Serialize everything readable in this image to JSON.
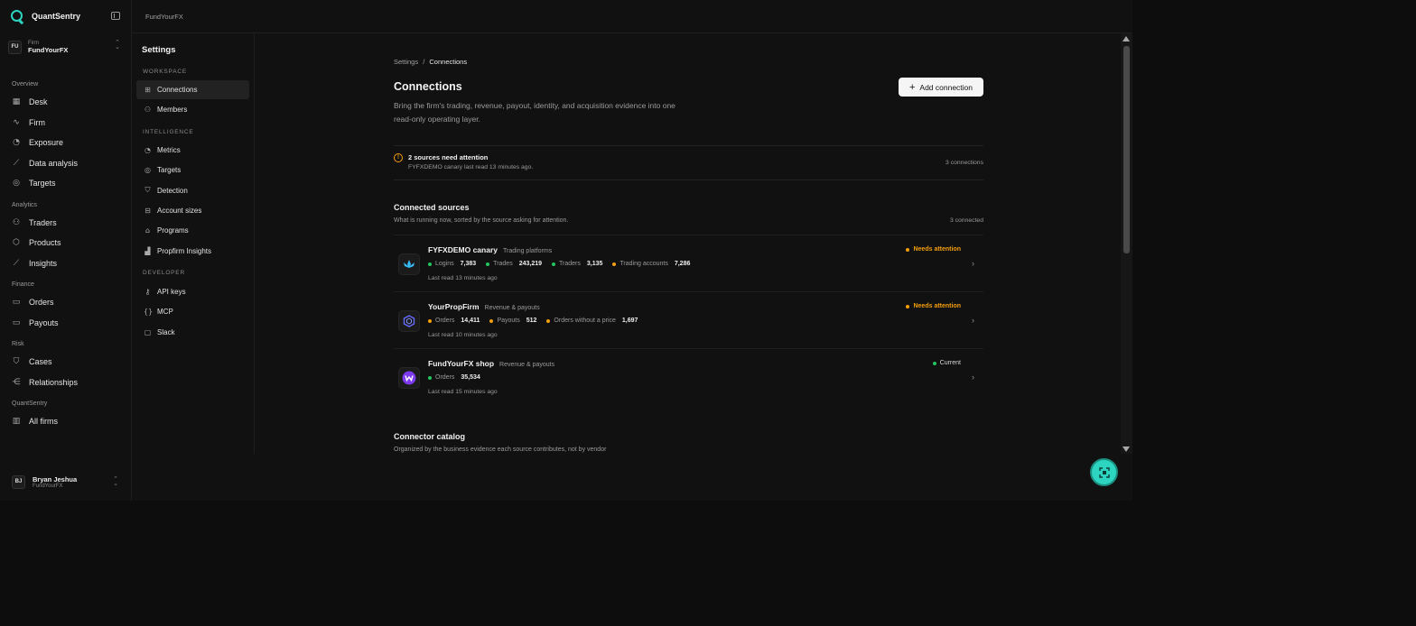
{
  "brand": {
    "name": "QuantSentry"
  },
  "firm_switcher": {
    "avatar": "FU",
    "caption": "Firm",
    "name": "FundYourFX"
  },
  "nav": [
    {
      "title": "Overview",
      "items": [
        {
          "label": "Desk",
          "icon": "grid-icon"
        },
        {
          "label": "Firm",
          "icon": "activity-icon"
        },
        {
          "label": "Exposure",
          "icon": "gauge-icon"
        },
        {
          "label": "Data analysis",
          "icon": "chart-line-icon"
        },
        {
          "label": "Targets",
          "icon": "target-icon"
        }
      ]
    },
    {
      "title": "Analytics",
      "items": [
        {
          "label": "Traders",
          "icon": "users-icon"
        },
        {
          "label": "Products",
          "icon": "box-icon"
        },
        {
          "label": "Insights",
          "icon": "chart-line-icon"
        }
      ]
    },
    {
      "title": "Finance",
      "items": [
        {
          "label": "Orders",
          "icon": "receipt-icon"
        },
        {
          "label": "Payouts",
          "icon": "wallet-icon"
        }
      ]
    },
    {
      "title": "Risk",
      "items": [
        {
          "label": "Cases",
          "icon": "shield-icon"
        },
        {
          "label": "Relationships",
          "icon": "share-icon"
        }
      ]
    },
    {
      "title": "QuantSentry",
      "items": [
        {
          "label": "All firms",
          "icon": "building-icon"
        }
      ]
    }
  ],
  "user": {
    "avatar": "BJ",
    "name": "Bryan Jeshua",
    "firm": "FundYourFX"
  },
  "topbar": {
    "title": "FundYourFX"
  },
  "settings": {
    "title": "Settings",
    "sections": [
      {
        "title": "WORKSPACE",
        "items": [
          {
            "label": "Connections",
            "icon": "plug-icon",
            "active": true
          },
          {
            "label": "Members",
            "icon": "users-icon"
          }
        ]
      },
      {
        "title": "INTELLIGENCE",
        "items": [
          {
            "label": "Metrics",
            "icon": "gauge-icon"
          },
          {
            "label": "Targets",
            "icon": "target-icon"
          },
          {
            "label": "Detection",
            "icon": "shield-check-icon"
          },
          {
            "label": "Account sizes",
            "icon": "database-icon"
          },
          {
            "label": "Programs",
            "icon": "landmark-icon"
          },
          {
            "label": "Propfirm Insights",
            "icon": "bar-chart-icon"
          }
        ]
      },
      {
        "title": "DEVELOPER",
        "items": [
          {
            "label": "API keys",
            "icon": "key-icon"
          },
          {
            "label": "MCP",
            "icon": "braces-icon"
          },
          {
            "label": "Slack",
            "icon": "message-icon"
          }
        ]
      }
    ]
  },
  "page": {
    "breadcrumb_root": "Settings",
    "breadcrumb_sep": "/",
    "breadcrumb_current": "Connections",
    "title": "Connections",
    "description": "Bring the firm's trading, revenue, payout, identity, and acquisition evidence into one read-only operating layer.",
    "add_button": "Add connection"
  },
  "alert": {
    "icon": "!",
    "title": "2 sources need attention",
    "subtitle": "FYFXDEMO canary last read 13 minutes ago.",
    "count": "3 connections"
  },
  "connected": {
    "title": "Connected sources",
    "subtitle": "What is running now, sorted by the source asking for attention.",
    "count": "3 connected",
    "rows": [
      {
        "name": "FYFXDEMO canary",
        "category": "Trading platforms",
        "logo": "lotus-icon",
        "status": "Needs attention",
        "status_color": "#f59e0b",
        "metrics": [
          {
            "label": "Logins",
            "value": "7,383",
            "color": "#22c55e"
          },
          {
            "label": "Trades",
            "value": "243,219",
            "color": "#22c55e"
          },
          {
            "label": "Traders",
            "value": "3,135",
            "color": "#22c55e"
          },
          {
            "label": "Trading accounts",
            "value": "7,286",
            "color": "#f59e0b"
          }
        ],
        "last_read": "Last read 13 minutes ago"
      },
      {
        "name": "YourPropFirm",
        "category": "Revenue & payouts",
        "logo": "hexagon-icon",
        "status": "Needs attention",
        "status_color": "#f59e0b",
        "metrics": [
          {
            "label": "Orders",
            "value": "14,411",
            "color": "#f59e0b"
          },
          {
            "label": "Payouts",
            "value": "512",
            "color": "#f59e0b"
          },
          {
            "label": "Orders without a price",
            "value": "1,697",
            "color": "#f59e0b"
          }
        ],
        "last_read": "Last read 10 minutes ago"
      },
      {
        "name": "FundYourFX shop",
        "category": "Revenue & payouts",
        "logo": "woo-icon",
        "status": "Current",
        "status_color": "#22c55e",
        "metrics": [
          {
            "label": "Orders",
            "value": "35,534",
            "color": "#22c55e"
          }
        ],
        "last_read": "Last read 15 minutes ago"
      }
    ]
  },
  "catalog": {
    "title": "Connector catalog",
    "subtitle": "Organized by the business evidence each source contributes, not by vendor"
  },
  "colors": {
    "accent": "#2dd4bf",
    "warning": "#f59e0b",
    "success": "#22c55e"
  }
}
